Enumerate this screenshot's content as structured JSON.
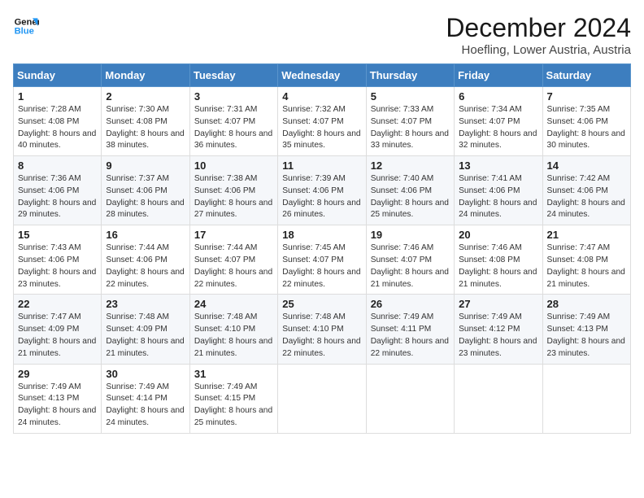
{
  "header": {
    "logo_line1": "General",
    "logo_line2": "Blue",
    "month": "December 2024",
    "location": "Hoefling, Lower Austria, Austria"
  },
  "weekdays": [
    "Sunday",
    "Monday",
    "Tuesday",
    "Wednesday",
    "Thursday",
    "Friday",
    "Saturday"
  ],
  "weeks": [
    [
      {
        "day": "1",
        "sunrise": "Sunrise: 7:28 AM",
        "sunset": "Sunset: 4:08 PM",
        "daylight": "Daylight: 8 hours and 40 minutes."
      },
      {
        "day": "2",
        "sunrise": "Sunrise: 7:30 AM",
        "sunset": "Sunset: 4:08 PM",
        "daylight": "Daylight: 8 hours and 38 minutes."
      },
      {
        "day": "3",
        "sunrise": "Sunrise: 7:31 AM",
        "sunset": "Sunset: 4:07 PM",
        "daylight": "Daylight: 8 hours and 36 minutes."
      },
      {
        "day": "4",
        "sunrise": "Sunrise: 7:32 AM",
        "sunset": "Sunset: 4:07 PM",
        "daylight": "Daylight: 8 hours and 35 minutes."
      },
      {
        "day": "5",
        "sunrise": "Sunrise: 7:33 AM",
        "sunset": "Sunset: 4:07 PM",
        "daylight": "Daylight: 8 hours and 33 minutes."
      },
      {
        "day": "6",
        "sunrise": "Sunrise: 7:34 AM",
        "sunset": "Sunset: 4:07 PM",
        "daylight": "Daylight: 8 hours and 32 minutes."
      },
      {
        "day": "7",
        "sunrise": "Sunrise: 7:35 AM",
        "sunset": "Sunset: 4:06 PM",
        "daylight": "Daylight: 8 hours and 30 minutes."
      }
    ],
    [
      {
        "day": "8",
        "sunrise": "Sunrise: 7:36 AM",
        "sunset": "Sunset: 4:06 PM",
        "daylight": "Daylight: 8 hours and 29 minutes."
      },
      {
        "day": "9",
        "sunrise": "Sunrise: 7:37 AM",
        "sunset": "Sunset: 4:06 PM",
        "daylight": "Daylight: 8 hours and 28 minutes."
      },
      {
        "day": "10",
        "sunrise": "Sunrise: 7:38 AM",
        "sunset": "Sunset: 4:06 PM",
        "daylight": "Daylight: 8 hours and 27 minutes."
      },
      {
        "day": "11",
        "sunrise": "Sunrise: 7:39 AM",
        "sunset": "Sunset: 4:06 PM",
        "daylight": "Daylight: 8 hours and 26 minutes."
      },
      {
        "day": "12",
        "sunrise": "Sunrise: 7:40 AM",
        "sunset": "Sunset: 4:06 PM",
        "daylight": "Daylight: 8 hours and 25 minutes."
      },
      {
        "day": "13",
        "sunrise": "Sunrise: 7:41 AM",
        "sunset": "Sunset: 4:06 PM",
        "daylight": "Daylight: 8 hours and 24 minutes."
      },
      {
        "day": "14",
        "sunrise": "Sunrise: 7:42 AM",
        "sunset": "Sunset: 4:06 PM",
        "daylight": "Daylight: 8 hours and 24 minutes."
      }
    ],
    [
      {
        "day": "15",
        "sunrise": "Sunrise: 7:43 AM",
        "sunset": "Sunset: 4:06 PM",
        "daylight": "Daylight: 8 hours and 23 minutes."
      },
      {
        "day": "16",
        "sunrise": "Sunrise: 7:44 AM",
        "sunset": "Sunset: 4:06 PM",
        "daylight": "Daylight: 8 hours and 22 minutes."
      },
      {
        "day": "17",
        "sunrise": "Sunrise: 7:44 AM",
        "sunset": "Sunset: 4:07 PM",
        "daylight": "Daylight: 8 hours and 22 minutes."
      },
      {
        "day": "18",
        "sunrise": "Sunrise: 7:45 AM",
        "sunset": "Sunset: 4:07 PM",
        "daylight": "Daylight: 8 hours and 22 minutes."
      },
      {
        "day": "19",
        "sunrise": "Sunrise: 7:46 AM",
        "sunset": "Sunset: 4:07 PM",
        "daylight": "Daylight: 8 hours and 21 minutes."
      },
      {
        "day": "20",
        "sunrise": "Sunrise: 7:46 AM",
        "sunset": "Sunset: 4:08 PM",
        "daylight": "Daylight: 8 hours and 21 minutes."
      },
      {
        "day": "21",
        "sunrise": "Sunrise: 7:47 AM",
        "sunset": "Sunset: 4:08 PM",
        "daylight": "Daylight: 8 hours and 21 minutes."
      }
    ],
    [
      {
        "day": "22",
        "sunrise": "Sunrise: 7:47 AM",
        "sunset": "Sunset: 4:09 PM",
        "daylight": "Daylight: 8 hours and 21 minutes."
      },
      {
        "day": "23",
        "sunrise": "Sunrise: 7:48 AM",
        "sunset": "Sunset: 4:09 PM",
        "daylight": "Daylight: 8 hours and 21 minutes."
      },
      {
        "day": "24",
        "sunrise": "Sunrise: 7:48 AM",
        "sunset": "Sunset: 4:10 PM",
        "daylight": "Daylight: 8 hours and 21 minutes."
      },
      {
        "day": "25",
        "sunrise": "Sunrise: 7:48 AM",
        "sunset": "Sunset: 4:10 PM",
        "daylight": "Daylight: 8 hours and 22 minutes."
      },
      {
        "day": "26",
        "sunrise": "Sunrise: 7:49 AM",
        "sunset": "Sunset: 4:11 PM",
        "daylight": "Daylight: 8 hours and 22 minutes."
      },
      {
        "day": "27",
        "sunrise": "Sunrise: 7:49 AM",
        "sunset": "Sunset: 4:12 PM",
        "daylight": "Daylight: 8 hours and 23 minutes."
      },
      {
        "day": "28",
        "sunrise": "Sunrise: 7:49 AM",
        "sunset": "Sunset: 4:13 PM",
        "daylight": "Daylight: 8 hours and 23 minutes."
      }
    ],
    [
      {
        "day": "29",
        "sunrise": "Sunrise: 7:49 AM",
        "sunset": "Sunset: 4:13 PM",
        "daylight": "Daylight: 8 hours and 24 minutes."
      },
      {
        "day": "30",
        "sunrise": "Sunrise: 7:49 AM",
        "sunset": "Sunset: 4:14 PM",
        "daylight": "Daylight: 8 hours and 24 minutes."
      },
      {
        "day": "31",
        "sunrise": "Sunrise: 7:49 AM",
        "sunset": "Sunset: 4:15 PM",
        "daylight": "Daylight: 8 hours and 25 minutes."
      },
      null,
      null,
      null,
      null
    ]
  ]
}
